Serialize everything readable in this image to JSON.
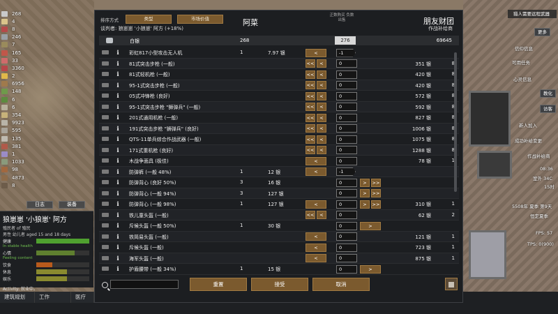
{
  "resources": [
    {
      "icon": "silver-icon",
      "value": "268",
      "color": "#c9c9c9"
    },
    {
      "icon": "figurine-icon",
      "value": "4",
      "color": "#d9c48a"
    },
    {
      "icon": "gem-icon",
      "value": "8",
      "color": "#b54a4a"
    },
    {
      "icon": "steel-icon",
      "value": "246",
      "color": "#9aa0a6"
    },
    {
      "icon": "component-icon",
      "value": "7",
      "color": "#9a8b5c"
    },
    {
      "icon": "meat-icon",
      "value": "165",
      "color": "#c0574a"
    },
    {
      "icon": "medicine-icon",
      "value": "33",
      "color": "#cf6b6b"
    },
    {
      "icon": "food-icon",
      "value": "3360",
      "color": "#b7464a"
    },
    {
      "icon": "gold-icon",
      "value": "2",
      "color": "#e0b84a"
    },
    {
      "icon": "wood-icon",
      "value": "6956",
      "color": "#a07a4c"
    },
    {
      "icon": "plant-icon",
      "value": "148",
      "color": "#6f9a4b"
    },
    {
      "icon": "herb-icon",
      "value": "6",
      "color": "#5d8b3f"
    },
    {
      "icon": "stone-icon",
      "value": "6",
      "color": "#b8b19c"
    },
    {
      "icon": "block-icon",
      "value": "354",
      "color": "#c7b27a"
    },
    {
      "icon": "block-icon",
      "value": "9923",
      "color": "#b9b4a8"
    },
    {
      "icon": "block-icon",
      "value": "595",
      "color": "#a9a49a"
    },
    {
      "icon": "block-icon",
      "value": "135",
      "color": "#bfbab0"
    },
    {
      "icon": "cloth-icon",
      "value": "381",
      "color": "#b05a4a"
    },
    {
      "icon": "cloth-icon",
      "value": "1",
      "color": "#9b8cc6"
    },
    {
      "icon": "cloth-icon",
      "value": "1033",
      "color": "#8a9a7c"
    },
    {
      "icon": "leather-icon",
      "value": "98",
      "color": "#a2683f"
    },
    {
      "icon": "leather-icon",
      "value": "4873",
      "color": "#8d6b4a"
    },
    {
      "icon": "leather-icon",
      "value": "8",
      "color": "#6d5c4a"
    }
  ],
  "log_tabs": {
    "log": "日志",
    "gear": "装备"
  },
  "pawn": {
    "name": "狼崽崽 '小狼崽' 阿方",
    "faction": "殖民者 of 殖民",
    "age": "男性 幼儿者 aged 15 and 18 days",
    "health_label": "健康",
    "health_note": "In stable health",
    "mood_label": "心情",
    "mood_note": "Feeling content",
    "food_label": "饮食",
    "rest_label": "休息",
    "joy_label": "娱乐",
    "activity": "Activity: 就业中。",
    "levels": {
      "health": 1.0,
      "mood": 0.72,
      "food": 0.3,
      "rest": 0.58,
      "joy": 0.58
    }
  },
  "bottom_tabs": [
    "建筑规划",
    "工作",
    "医疗"
  ],
  "trade": {
    "sort_label": "排序方式",
    "sort_by_category": "类型",
    "sort_by_market": "市场价值",
    "negotiator": "谈判者: 狼崽崽 '小狼崽' 阿方 (+18%)",
    "colony": "阿菜",
    "faction": "朋友财团",
    "trader_kind": "作战补给商",
    "head_note": "正数购买 负数出售",
    "silver": {
      "name": "白银",
      "ours": "268",
      "field": "276",
      "theirs": "69645"
    },
    "rows": [
      {
        "icon": "drone-icon",
        "name": "彩虹817小型攻击无人机",
        "our_count": "1",
        "our_value": "7.97 银",
        "their_value": "",
        "their_count": "",
        "qty": "-1",
        "neg": true,
        "left_btns": [
          "<"
        ],
        "right_btns": []
      },
      {
        "icon": "rifle-icon",
        "name": "81式突击步枪 (一般)",
        "our_count": "",
        "our_value": "",
        "their_value": "351 银",
        "their_count": "8",
        "qty": "0",
        "neg": false,
        "left_btns": [
          "<<",
          "<"
        ],
        "right_btns": []
      },
      {
        "icon": "rifle-icon",
        "name": "81式轻机枪 (一般)",
        "our_count": "",
        "our_value": "",
        "their_value": "420 银",
        "their_count": "8",
        "qty": "0",
        "neg": false,
        "left_btns": [
          "<<",
          "<"
        ],
        "right_btns": []
      },
      {
        "icon": "rifle-icon",
        "name": "95-1式突击步枪 (一般)",
        "our_count": "",
        "our_value": "",
        "their_value": "420 银",
        "their_count": "8",
        "qty": "0",
        "neg": false,
        "left_btns": [
          "<<",
          "<"
        ],
        "right_btns": []
      },
      {
        "icon": "rifle-icon",
        "name": "05式冲锋枪 (良好)",
        "our_count": "",
        "our_value": "",
        "their_value": "572 银",
        "their_count": "8",
        "qty": "0",
        "neg": false,
        "left_btns": [
          "<<",
          "<"
        ],
        "right_btns": []
      },
      {
        "icon": "rifle-icon",
        "name": "95-1式突击步枪 \"狮弹兵\" (一般)",
        "our_count": "",
        "our_value": "",
        "their_value": "592 银",
        "their_count": "8",
        "qty": "0",
        "neg": false,
        "left_btns": [
          "<<",
          "<"
        ],
        "right_btns": []
      },
      {
        "icon": "rifle-icon",
        "name": "201式通用机枪 (一般)",
        "our_count": "",
        "our_value": "",
        "their_value": "827 银",
        "their_count": "8",
        "qty": "0",
        "neg": false,
        "left_btns": [
          "<<",
          "<"
        ],
        "right_btns": []
      },
      {
        "icon": "rifle-icon",
        "name": "191式突击步枪 \"狮弹兵\" (良好)",
        "our_count": "",
        "our_value": "",
        "their_value": "1006 银",
        "their_count": "8",
        "qty": "0",
        "neg": false,
        "left_btns": [
          "<<",
          "<"
        ],
        "right_btns": []
      },
      {
        "icon": "rifle-icon",
        "name": "QTS-11单兵综合作战武器 (一般)",
        "our_count": "",
        "our_value": "",
        "their_value": "1075 银",
        "their_count": "8",
        "qty": "0",
        "neg": false,
        "left_btns": [
          "<<",
          "<"
        ],
        "right_btns": []
      },
      {
        "icon": "rifle-icon",
        "name": "171式重机枪 (良好)",
        "our_count": "",
        "our_value": "",
        "their_value": "1288 银",
        "their_count": "8",
        "qty": "0",
        "neg": false,
        "left_btns": [
          "<<",
          "<"
        ],
        "right_btns": []
      },
      {
        "icon": "mask-icon",
        "name": "木战争面具 (极佳)",
        "our_count": "",
        "our_value": "",
        "their_value": "78 银",
        "their_count": "1",
        "qty": "0",
        "neg": false,
        "left_btns": [
          "<"
        ],
        "right_btns": []
      },
      {
        "icon": "pants-icon",
        "name": "防弹裤 (一般 48%)",
        "our_count": "1",
        "our_value": "12 银",
        "their_value": "",
        "their_count": "",
        "qty": "-1",
        "neg": true,
        "left_btns": [
          "<"
        ],
        "right_btns": []
      },
      {
        "icon": "vest-icon",
        "name": "防弹背心 (良好 50%)",
        "our_count": "3",
        "our_value": "16 银",
        "their_value": "",
        "their_count": "",
        "qty": "0",
        "neg": false,
        "left_btns": [],
        "right_btns": [
          ">",
          ">>"
        ]
      },
      {
        "icon": "vest-icon",
        "name": "防弹背心 (一般 94%)",
        "our_count": "3",
        "our_value": "127 银",
        "their_value": "",
        "their_count": "",
        "qty": "0",
        "neg": false,
        "left_btns": [],
        "right_btns": [
          ">",
          ">>"
        ]
      },
      {
        "icon": "vest-icon",
        "name": "防弹背心 (一般 98%)",
        "our_count": "1",
        "our_value": "127 银",
        "their_value": "310 银",
        "their_count": "1",
        "qty": "0",
        "neg": false,
        "left_btns": [
          "<"
        ],
        "right_btns": [
          ">",
          ">>"
        ]
      },
      {
        "icon": "vest-icon",
        "name": "铁儿童头盔 (一般)",
        "our_count": "",
        "our_value": "",
        "their_value": "62 银",
        "their_count": "2",
        "qty": "0",
        "neg": false,
        "left_btns": [
          "<<",
          "<"
        ],
        "right_btns": []
      },
      {
        "icon": "helmet-icon",
        "name": "斥候头盔 (一般 50%)",
        "our_count": "1",
        "our_value": "30 银",
        "their_value": "",
        "their_count": "",
        "qty": "0",
        "neg": false,
        "left_btns": [],
        "right_btns": [
          ">"
        ]
      },
      {
        "icon": "helmet-icon",
        "name": "铁简易头盔 (一般)",
        "our_count": "",
        "our_value": "",
        "their_value": "121 银",
        "their_count": "1",
        "qty": "0",
        "neg": false,
        "left_btns": [
          "<"
        ],
        "right_btns": []
      },
      {
        "icon": "helmet-icon",
        "name": "斥候头盔 (一般)",
        "our_count": "",
        "our_value": "",
        "their_value": "723 银",
        "their_count": "1",
        "qty": "0",
        "neg": false,
        "left_btns": [
          "<"
        ],
        "right_btns": []
      },
      {
        "icon": "helmet-icon",
        "name": "海军头盔 (一般)",
        "our_count": "",
        "our_value": "",
        "their_value": "875 银",
        "their_count": "1",
        "qty": "0",
        "neg": false,
        "left_btns": [
          "<"
        ],
        "right_btns": []
      },
      {
        "icon": "belt-icon",
        "name": "护盾腰带 (一般 34%)",
        "our_count": "1",
        "our_value": "15 银",
        "their_value": "",
        "their_count": "",
        "qty": "0",
        "neg": false,
        "left_btns": [],
        "right_btns": [
          ">"
        ]
      }
    ],
    "search_placeholder": "",
    "reset": "重置",
    "accept": "接受",
    "cancel": "取消"
  },
  "right_ui": {
    "alert": "猎人需要远程武器",
    "buttons": [
      "更多",
      "信仰信息",
      "可用任务",
      "心灵信息",
      "教化",
      "访客",
      "新人加入",
      "成功补给变更",
      "作战补给商"
    ],
    "time": "08:36",
    "temperature": "室外 34C",
    "hour": "15时",
    "date": "5508年 夏季 第9天",
    "speed": "恒定夏季",
    "fps": "FPS: 57",
    "tps": "TPS: 0(900)"
  }
}
